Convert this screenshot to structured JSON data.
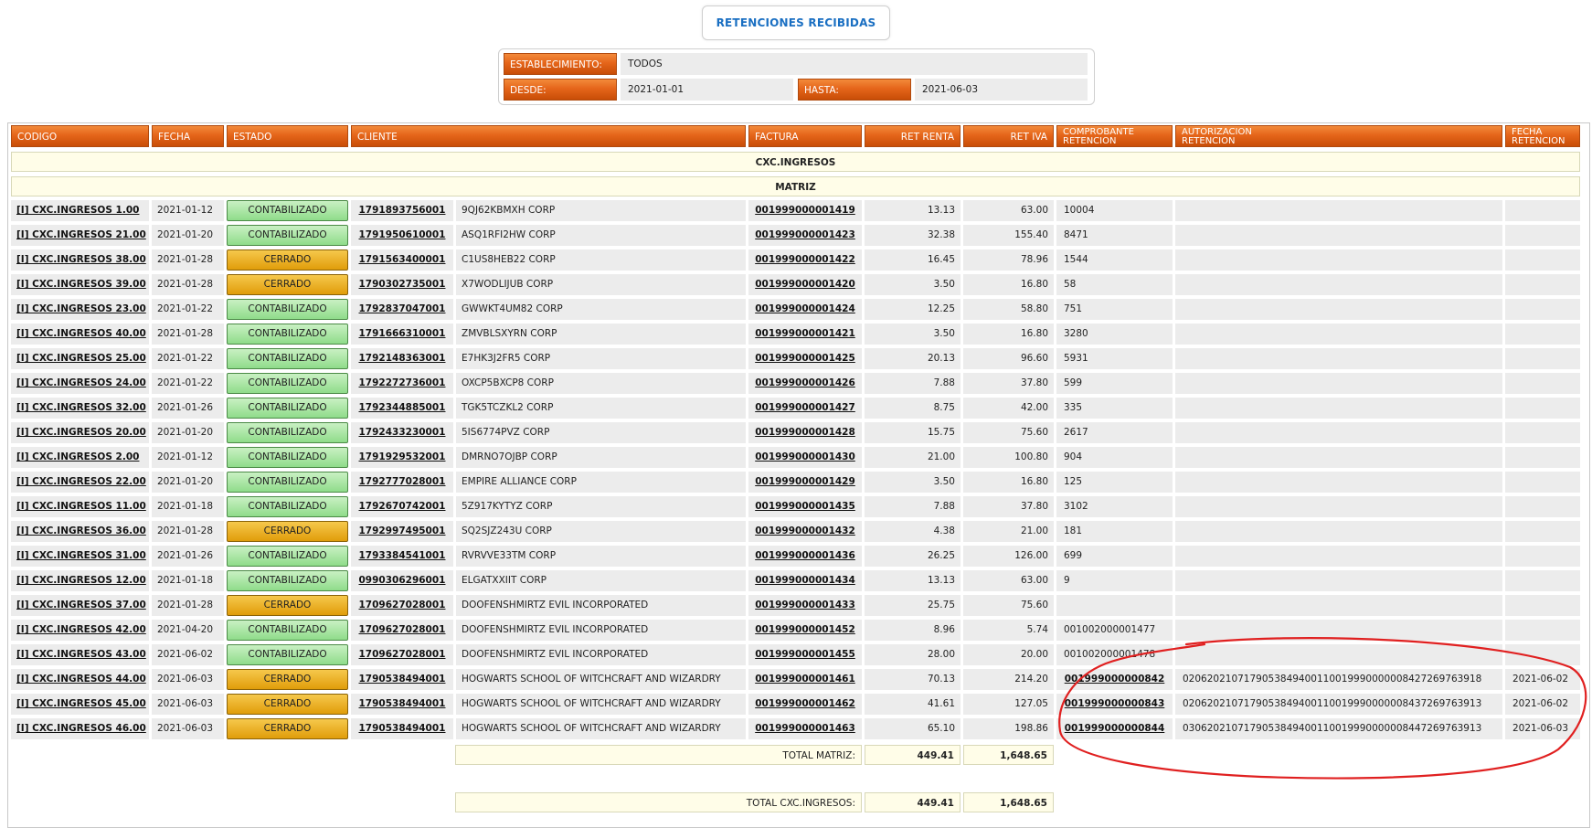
{
  "page": {
    "title": "RETENCIONES RECIBIDAS"
  },
  "filters": {
    "establecimiento_label": "ESTABLECIMIENTO:",
    "establecimiento_value": "TODOS",
    "desde_label": "DESDE:",
    "desde_value": "2021-01-01",
    "hasta_label": "HASTA:",
    "hasta_value": "2021-06-03"
  },
  "table": {
    "headers": {
      "codigo": "CODIGO",
      "fecha": "FECHA",
      "estado": "ESTADO",
      "cliente": "CLIENTE",
      "factura": "FACTURA",
      "ret_renta": "RET RENTA",
      "ret_iva": "RET IVA",
      "comprobante_1": "COMPROBANTE",
      "comprobante_2": "RETENCION",
      "autorizacion_1": "AUTORIZACION",
      "autorizacion_2": "RETENCION",
      "fecha_ret_1": "FECHA",
      "fecha_ret_2": "RETENCION"
    },
    "group": "CXC.INGRESOS",
    "subgroup": "MATRIZ",
    "rows": [
      {
        "codigo": "[I] CXC.INGRESOS 1.00",
        "fecha": "2021-01-12",
        "estado": "CONTABILIZADO",
        "ruc": "1791893756001",
        "cliente": "9QJ62KBMXH CORP",
        "factura": "001999000001419",
        "ret_renta": "13.13",
        "ret_iva": "63.00",
        "comprobante": "10004",
        "autorizacion": "",
        "fecha_ret": ""
      },
      {
        "codigo": "[I] CXC.INGRESOS 21.00",
        "fecha": "2021-01-20",
        "estado": "CONTABILIZADO",
        "ruc": "1791950610001",
        "cliente": "ASQ1RFI2HW CORP",
        "factura": "001999000001423",
        "ret_renta": "32.38",
        "ret_iva": "155.40",
        "comprobante": "8471",
        "autorizacion": "",
        "fecha_ret": ""
      },
      {
        "codigo": "[I] CXC.INGRESOS 38.00",
        "fecha": "2021-01-28",
        "estado": "CERRADO",
        "ruc": "1791563400001",
        "cliente": "C1US8HEB22 CORP",
        "factura": "001999000001422",
        "ret_renta": "16.45",
        "ret_iva": "78.96",
        "comprobante": "1544",
        "autorizacion": "",
        "fecha_ret": ""
      },
      {
        "codigo": "[I] CXC.INGRESOS 39.00",
        "fecha": "2021-01-28",
        "estado": "CERRADO",
        "ruc": "1790302735001",
        "cliente": "X7WODLIJUB CORP",
        "factura": "001999000001420",
        "ret_renta": "3.50",
        "ret_iva": "16.80",
        "comprobante": "58",
        "autorizacion": "",
        "fecha_ret": ""
      },
      {
        "codigo": "[I] CXC.INGRESOS 23.00",
        "fecha": "2021-01-22",
        "estado": "CONTABILIZADO",
        "ruc": "1792837047001",
        "cliente": "GWWKT4UM82 CORP",
        "factura": "001999000001424",
        "ret_renta": "12.25",
        "ret_iva": "58.80",
        "comprobante": "751",
        "autorizacion": "",
        "fecha_ret": ""
      },
      {
        "codigo": "[I] CXC.INGRESOS 40.00",
        "fecha": "2021-01-28",
        "estado": "CONTABILIZADO",
        "ruc": "1791666310001",
        "cliente": "ZMVBLSXYRN CORP",
        "factura": "001999000001421",
        "ret_renta": "3.50",
        "ret_iva": "16.80",
        "comprobante": "3280",
        "autorizacion": "",
        "fecha_ret": ""
      },
      {
        "codigo": "[I] CXC.INGRESOS 25.00",
        "fecha": "2021-01-22",
        "estado": "CONTABILIZADO",
        "ruc": "1792148363001",
        "cliente": "E7HK3J2FR5 CORP",
        "factura": "001999000001425",
        "ret_renta": "20.13",
        "ret_iva": "96.60",
        "comprobante": "5931",
        "autorizacion": "",
        "fecha_ret": ""
      },
      {
        "codigo": "[I] CXC.INGRESOS 24.00",
        "fecha": "2021-01-22",
        "estado": "CONTABILIZADO",
        "ruc": "1792272736001",
        "cliente": "OXCP5BXCP8 CORP",
        "factura": "001999000001426",
        "ret_renta": "7.88",
        "ret_iva": "37.80",
        "comprobante": "599",
        "autorizacion": "",
        "fecha_ret": ""
      },
      {
        "codigo": "[I] CXC.INGRESOS 32.00",
        "fecha": "2021-01-26",
        "estado": "CONTABILIZADO",
        "ruc": "1792344885001",
        "cliente": "TGK5TCZKL2 CORP",
        "factura": "001999000001427",
        "ret_renta": "8.75",
        "ret_iva": "42.00",
        "comprobante": "335",
        "autorizacion": "",
        "fecha_ret": ""
      },
      {
        "codigo": "[I] CXC.INGRESOS 20.00",
        "fecha": "2021-01-20",
        "estado": "CONTABILIZADO",
        "ruc": "1792433230001",
        "cliente": "5IS6774PVZ CORP",
        "factura": "001999000001428",
        "ret_renta": "15.75",
        "ret_iva": "75.60",
        "comprobante": "2617",
        "autorizacion": "",
        "fecha_ret": ""
      },
      {
        "codigo": "[I] CXC.INGRESOS 2.00",
        "fecha": "2021-01-12",
        "estado": "CONTABILIZADO",
        "ruc": "1791929532001",
        "cliente": "DMRNO7OJBP CORP",
        "factura": "001999000001430",
        "ret_renta": "21.00",
        "ret_iva": "100.80",
        "comprobante": "904",
        "autorizacion": "",
        "fecha_ret": ""
      },
      {
        "codigo": "[I] CXC.INGRESOS 22.00",
        "fecha": "2021-01-20",
        "estado": "CONTABILIZADO",
        "ruc": "1792777028001",
        "cliente": "EMPIRE ALLIANCE CORP",
        "factura": "001999000001429",
        "ret_renta": "3.50",
        "ret_iva": "16.80",
        "comprobante": "125",
        "autorizacion": "",
        "fecha_ret": ""
      },
      {
        "codigo": "[I] CXC.INGRESOS 11.00",
        "fecha": "2021-01-18",
        "estado": "CONTABILIZADO",
        "ruc": "1792670742001",
        "cliente": "5Z917KYTYZ CORP",
        "factura": "001999000001435",
        "ret_renta": "7.88",
        "ret_iva": "37.80",
        "comprobante": "3102",
        "autorizacion": "",
        "fecha_ret": ""
      },
      {
        "codigo": "[I] CXC.INGRESOS 36.00",
        "fecha": "2021-01-28",
        "estado": "CERRADO",
        "ruc": "1792997495001",
        "cliente": "SQ2SJZ243U CORP",
        "factura": "001999000001432",
        "ret_renta": "4.38",
        "ret_iva": "21.00",
        "comprobante": "181",
        "autorizacion": "",
        "fecha_ret": ""
      },
      {
        "codigo": "[I] CXC.INGRESOS 31.00",
        "fecha": "2021-01-26",
        "estado": "CONTABILIZADO",
        "ruc": "1793384541001",
        "cliente": "RVRVVE33TM CORP",
        "factura": "001999000001436",
        "ret_renta": "26.25",
        "ret_iva": "126.00",
        "comprobante": "699",
        "autorizacion": "",
        "fecha_ret": ""
      },
      {
        "codigo": "[I] CXC.INGRESOS 12.00",
        "fecha": "2021-01-18",
        "estado": "CONTABILIZADO",
        "ruc": "0990306296001",
        "cliente": "ELGATXXIIT CORP",
        "factura": "001999000001434",
        "ret_renta": "13.13",
        "ret_iva": "63.00",
        "comprobante": "9",
        "autorizacion": "",
        "fecha_ret": ""
      },
      {
        "codigo": "[I] CXC.INGRESOS 37.00",
        "fecha": "2021-01-28",
        "estado": "CERRADO",
        "ruc": "1709627028001",
        "cliente": "DOOFENSHMIRTZ EVIL INCORPORATED",
        "factura": "001999000001433",
        "ret_renta": "25.75",
        "ret_iva": "75.60",
        "comprobante": "",
        "autorizacion": "",
        "fecha_ret": ""
      },
      {
        "codigo": "[I] CXC.INGRESOS 42.00",
        "fecha": "2021-04-20",
        "estado": "CONTABILIZADO",
        "ruc": "1709627028001",
        "cliente": "DOOFENSHMIRTZ EVIL INCORPORATED",
        "factura": "001999000001452",
        "ret_renta": "8.96",
        "ret_iva": "5.74",
        "comprobante": "001002000001477",
        "autorizacion": "",
        "fecha_ret": ""
      },
      {
        "codigo": "[I] CXC.INGRESOS 43.00",
        "fecha": "2021-06-02",
        "estado": "CONTABILIZADO",
        "ruc": "1709627028001",
        "cliente": "DOOFENSHMIRTZ EVIL INCORPORATED",
        "factura": "001999000001455",
        "ret_renta": "28.00",
        "ret_iva": "20.00",
        "comprobante": "001002000001478",
        "autorizacion": "",
        "fecha_ret": ""
      },
      {
        "codigo": "[I] CXC.INGRESOS 44.00",
        "fecha": "2021-06-03",
        "estado": "CERRADO",
        "ruc": "1790538494001",
        "cliente": "HOGWARTS SCHOOL OF WITCHCRAFT AND WIZARDRY",
        "factura": "001999000001461",
        "ret_renta": "70.13",
        "ret_iva": "214.20",
        "comprobante": "001999000000842",
        "autorizacion": "0206202107179053849400110019990000008427269763918",
        "fecha_ret": "2021-06-02"
      },
      {
        "codigo": "[I] CXC.INGRESOS 45.00",
        "fecha": "2021-06-03",
        "estado": "CERRADO",
        "ruc": "1790538494001",
        "cliente": "HOGWARTS SCHOOL OF WITCHCRAFT AND WIZARDRY",
        "factura": "001999000001462",
        "ret_renta": "41.61",
        "ret_iva": "127.05",
        "comprobante": "001999000000843",
        "autorizacion": "0206202107179053849400110019990000008437269763913",
        "fecha_ret": "2021-06-02"
      },
      {
        "codigo": "[I] CXC.INGRESOS 46.00",
        "fecha": "2021-06-03",
        "estado": "CERRADO",
        "ruc": "1790538494001",
        "cliente": "HOGWARTS SCHOOL OF WITCHCRAFT AND WIZARDRY",
        "factura": "001999000001463",
        "ret_renta": "65.10",
        "ret_iva": "198.86",
        "comprobante": "001999000000844",
        "autorizacion": "0306202107179053849400110019990000008447269763913",
        "fecha_ret": "2021-06-03"
      }
    ],
    "totals": {
      "matriz_label": "TOTAL MATRIZ:",
      "matriz_renta": "449.41",
      "matriz_iva": "1,648.65",
      "cxc_label": "TOTAL CXC.INGRESOS:",
      "cxc_renta": "449.41",
      "cxc_iva": "1,648.65"
    }
  },
  "colors": {
    "header_orange": "#e5651a",
    "badge_contabilizado": "#a8e6a2",
    "badge_cerrado": "#f0b020",
    "title_blue": "#1a6fc2",
    "annotation_red": "#e02020"
  }
}
